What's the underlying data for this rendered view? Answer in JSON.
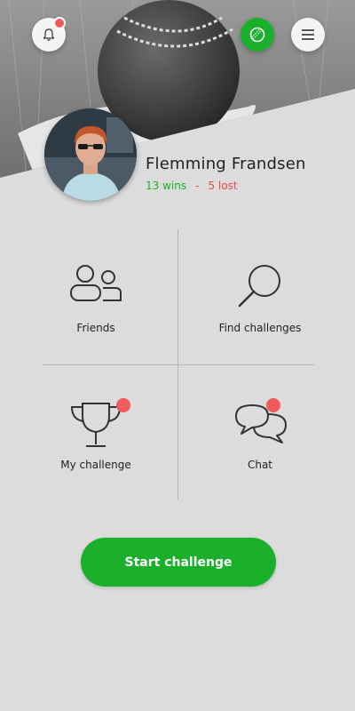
{
  "header": {
    "notification_icon": "bell-icon",
    "sport_icon": "cricket-ball-icon",
    "menu_icon": "hamburger-menu-icon",
    "has_notification": true
  },
  "profile": {
    "name": "Flemming Frandsen",
    "wins": "13 wins",
    "separator": "-",
    "lost": "5 lost"
  },
  "tiles": [
    {
      "label": "Friends",
      "icon": "friends-icon",
      "badge": false
    },
    {
      "label": "Find challenges",
      "icon": "search-icon",
      "badge": false
    },
    {
      "label": "My challenge",
      "icon": "trophy-icon",
      "badge": true
    },
    {
      "label": "Chat",
      "icon": "chat-bubbles-icon",
      "badge": true
    }
  ],
  "actions": {
    "start_label": "Start challenge"
  },
  "colors": {
    "accent_green": "#1ab02c",
    "badge_red": "#f05a5a",
    "lost_red": "#e84a4a",
    "background": "#dcdcdc"
  }
}
